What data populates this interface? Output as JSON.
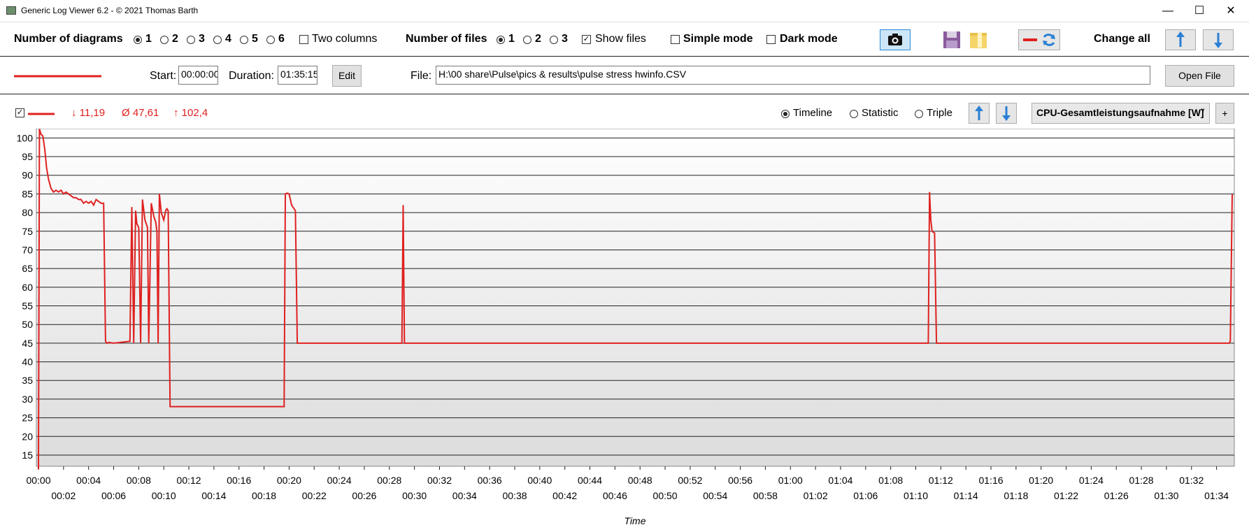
{
  "window": {
    "title": "Generic Log Viewer 6.2 - © 2021 Thomas Barth",
    "minimize_glyph": "—",
    "maximize_glyph": "☐",
    "close_glyph": "✕"
  },
  "toolbar": {
    "diagrams_label": "Number of diagrams",
    "diagram_options": [
      "1",
      "2",
      "3",
      "4",
      "5",
      "6"
    ],
    "diagrams_selected": "1",
    "two_columns_label": "Two columns",
    "files_label": "Number of files",
    "file_options": [
      "1",
      "2",
      "3"
    ],
    "files_selected": "1",
    "show_files_label": "Show files",
    "show_files_checked": true,
    "simple_mode_label": "Simple mode",
    "dark_mode_label": "Dark mode",
    "change_all_label": "Change all",
    "icons": [
      "camera-icon",
      "save-icon",
      "folder-icon",
      "line-style-icon",
      "refresh-icon",
      "arrow-up-icon",
      "arrow-down-icon"
    ]
  },
  "file_row": {
    "start_label": "Start:",
    "start_value": "00:00:00",
    "duration_label": "Duration:",
    "duration_value": "01:35:15",
    "edit_label": "Edit",
    "file_label": "File:",
    "file_path": "H:\\00 share\\Pulse\\pics & results\\pulse stress hwinfo.CSV",
    "open_file_label": "Open File",
    "line_color": "#e02020"
  },
  "diagram": {
    "min_label": "↓ 11,19",
    "avg_label": "Ø 47,61",
    "max_label": "↑ 102,4",
    "view_options": [
      "Timeline",
      "Statistic",
      "Triple"
    ],
    "view_selected": "Timeline",
    "sensor_selected": "CPU-Gesamtleistungsaufnahme [W]",
    "add_label": "+",
    "series_color": "#e02020"
  },
  "chart_data": {
    "type": "line",
    "xlabel": "Time",
    "ylabel": "",
    "ylim": [
      12,
      102.5
    ],
    "xlim_minutes": [
      0,
      95.25
    ],
    "yticks": [
      15,
      20,
      25,
      30,
      35,
      40,
      45,
      50,
      55,
      60,
      65,
      70,
      75,
      80,
      85,
      90,
      95,
      100
    ],
    "xticks_upper": [
      "00:00",
      "00:04",
      "00:08",
      "00:12",
      "00:16",
      "00:20",
      "00:24",
      "00:28",
      "00:32",
      "00:36",
      "00:40",
      "00:44",
      "00:48",
      "00:52",
      "00:56",
      "01:00",
      "01:04",
      "01:08",
      "01:12",
      "01:16",
      "01:20",
      "01:24",
      "01:28",
      "01:32"
    ],
    "xticks_lower": [
      "00:02",
      "00:06",
      "00:10",
      "00:14",
      "00:18",
      "00:22",
      "00:26",
      "00:30",
      "00:34",
      "00:38",
      "00:42",
      "00:46",
      "00:50",
      "00:54",
      "00:58",
      "01:02",
      "01:06",
      "01:10",
      "01:14",
      "01:18",
      "01:22",
      "01:26",
      "01:30",
      "01:34"
    ],
    "grid": true,
    "series": [
      {
        "x_minutes": [
          0,
          0.08,
          0.2,
          0.35,
          0.5,
          0.65,
          0.8,
          1.0,
          1.2,
          1.4,
          1.6,
          1.8,
          2.0,
          2.2,
          2.4,
          2.6,
          2.8,
          3.0,
          3.2,
          3.4,
          3.6,
          3.8,
          4.0,
          4.2,
          4.4,
          4.6,
          4.8,
          5.0,
          5.2,
          5.35,
          5.45,
          5.5,
          5.6,
          6.0,
          7.3,
          7.45,
          7.6,
          7.75,
          7.85,
          8.0,
          8.15,
          8.3,
          8.5,
          8.6,
          8.7,
          8.8,
          9.0,
          9.2,
          9.35,
          9.45,
          9.55,
          9.65,
          9.8,
          10.0,
          10.15,
          10.25,
          10.35,
          10.5,
          10.7,
          10.9,
          11.1,
          11.3,
          11.4,
          11.5,
          11.6,
          19.6,
          19.7,
          19.85,
          20.0,
          20.2,
          20.5,
          20.65,
          20.8,
          21.0,
          21.1,
          21.3,
          28.8,
          29.0,
          29.1,
          29.2,
          29.3,
          29.45,
          70.8,
          71.0,
          71.1,
          71.2,
          71.3,
          71.5,
          71.65,
          71.8,
          95.0,
          95.1,
          95.25
        ],
        "values": [
          11.2,
          102.4,
          101,
          100.5,
          97,
          92,
          89,
          86.5,
          85.5,
          86,
          85.5,
          86,
          85,
          85.5,
          85,
          84.5,
          84,
          84,
          83.5,
          83.5,
          82.5,
          83,
          82.5,
          83,
          82,
          83.5,
          83,
          82.5,
          82.5,
          45.5,
          45,
          45,
          45.2,
          45,
          45.5,
          81.5,
          45,
          80.5,
          77,
          76,
          45,
          83.5,
          78,
          77,
          76,
          45,
          82.5,
          79,
          77.5,
          75,
          45,
          85,
          80,
          78,
          80.5,
          81,
          80.5,
          28,
          28,
          28,
          28,
          28,
          28,
          28,
          28,
          28,
          85,
          85.2,
          85,
          82,
          80.5,
          45,
          45,
          45,
          45,
          45,
          45,
          45,
          82,
          45,
          45,
          45,
          45,
          45,
          85.5,
          78,
          75,
          74.5,
          45,
          45,
          45,
          45.5,
          85
        ]
      }
    ]
  }
}
